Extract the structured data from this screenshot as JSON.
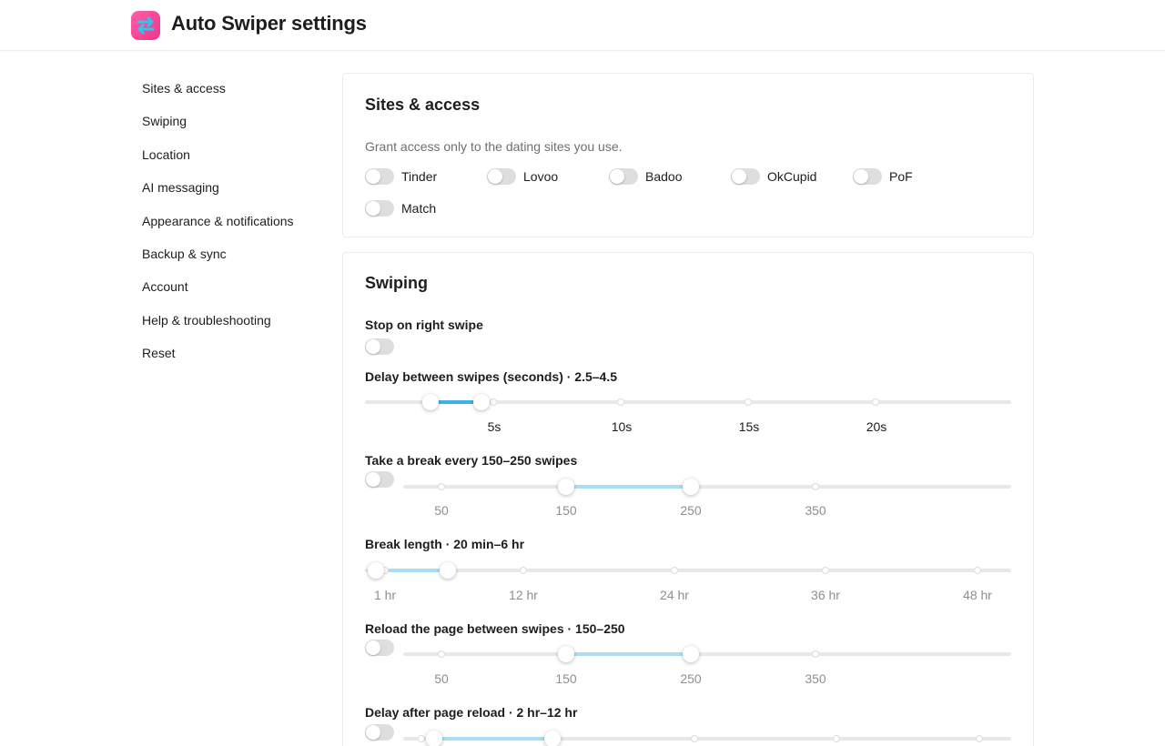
{
  "header": {
    "title": "Auto Swiper settings",
    "logo_icon": "swap-arrows-icon",
    "logo_color": "#f0338c"
  },
  "sidebar": {
    "items": [
      {
        "label": "Sites & access"
      },
      {
        "label": "Swiping"
      },
      {
        "label": "Location"
      },
      {
        "label": "AI messaging"
      },
      {
        "label": "Appearance & notifications"
      },
      {
        "label": "Backup & sync"
      },
      {
        "label": "Account"
      },
      {
        "label": "Help & troubleshooting"
      },
      {
        "label": "Reset"
      }
    ]
  },
  "sites": {
    "title": "Sites & access",
    "description": "Grant access only to the dating sites you use.",
    "items": [
      {
        "label": "Tinder",
        "enabled": false
      },
      {
        "label": "Lovoo",
        "enabled": false
      },
      {
        "label": "Badoo",
        "enabled": false
      },
      {
        "label": "OkCupid",
        "enabled": false
      },
      {
        "label": "PoF",
        "enabled": false
      },
      {
        "label": "Match",
        "enabled": false
      }
    ]
  },
  "swiping": {
    "title": "Swiping",
    "stop_on_right_swipe": {
      "label": "Stop on right swipe",
      "enabled": false
    },
    "delay_between_swipes": {
      "label": "Delay between swipes (seconds) · 2.5–4.5",
      "ticks": [
        "5s",
        "10s",
        "15s",
        "20s"
      ],
      "range": [
        2.5,
        4.5
      ],
      "fill_color": "#3fb1e8"
    },
    "break_every": {
      "label": "Take a break every 150–250 swipes",
      "enabled": false,
      "ticks": [
        "50",
        "150",
        "250",
        "350"
      ],
      "range": [
        150,
        250
      ],
      "fill_color": "#a9def3"
    },
    "break_length": {
      "label": "Break length · 20 min–6 hr",
      "ticks": [
        "1 hr",
        "12 hr",
        "24 hr",
        "36 hr",
        "48 hr"
      ],
      "range": [
        "20 min",
        "6 hr"
      ],
      "fill_color": "#a9def3"
    },
    "reload_page": {
      "label": "Reload the page between swipes · 150–250",
      "enabled": false,
      "ticks": [
        "50",
        "150",
        "250",
        "350"
      ],
      "range": [
        150,
        250
      ],
      "fill_color": "#a9def3"
    },
    "delay_after_reload": {
      "label": "Delay after page reload · 2 hr–12 hr",
      "enabled": false,
      "range": [
        "2 hr",
        "12 hr"
      ],
      "fill_color": "#a9def3"
    }
  }
}
